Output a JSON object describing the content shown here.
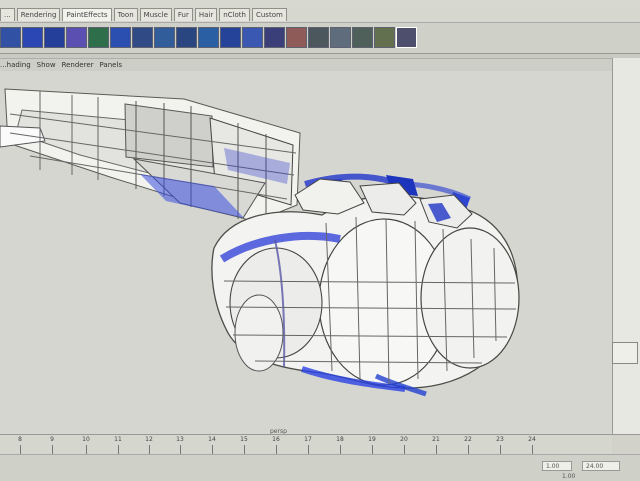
{
  "shelf_tabs": [
    "...",
    "Rendering",
    "PaintEffects",
    "Toon",
    "Muscle",
    "Fur",
    "Hair",
    "nCloth",
    "Custom"
  ],
  "shelf_tab_display": [
    {
      "label": "..."
    },
    {
      "label": "Rendering"
    },
    {
      "label": "PaintEffects"
    },
    {
      "label": "Toon"
    },
    {
      "label": "Muscle"
    },
    {
      "label": "Fur"
    },
    {
      "label": "Hair"
    },
    {
      "label": "nCloth"
    },
    {
      "label": "Custom"
    }
  ],
  "panel_menu": [
    "...hading",
    "Show",
    "Renderer",
    "Panels"
  ],
  "viewport": {
    "camera_label": "persp"
  },
  "timeline": {
    "ticks": [
      8,
      9,
      10,
      11,
      12,
      13,
      14,
      15,
      16,
      17,
      18,
      19,
      20,
      21,
      22,
      23,
      24
    ],
    "current_frame": "1.00"
  },
  "range": {
    "start": "1.00",
    "end": "24.00"
  },
  "colors": {
    "accent": "#1f3ad8",
    "mesh": "#f3f3f1",
    "panel": "#cfd0c8"
  }
}
